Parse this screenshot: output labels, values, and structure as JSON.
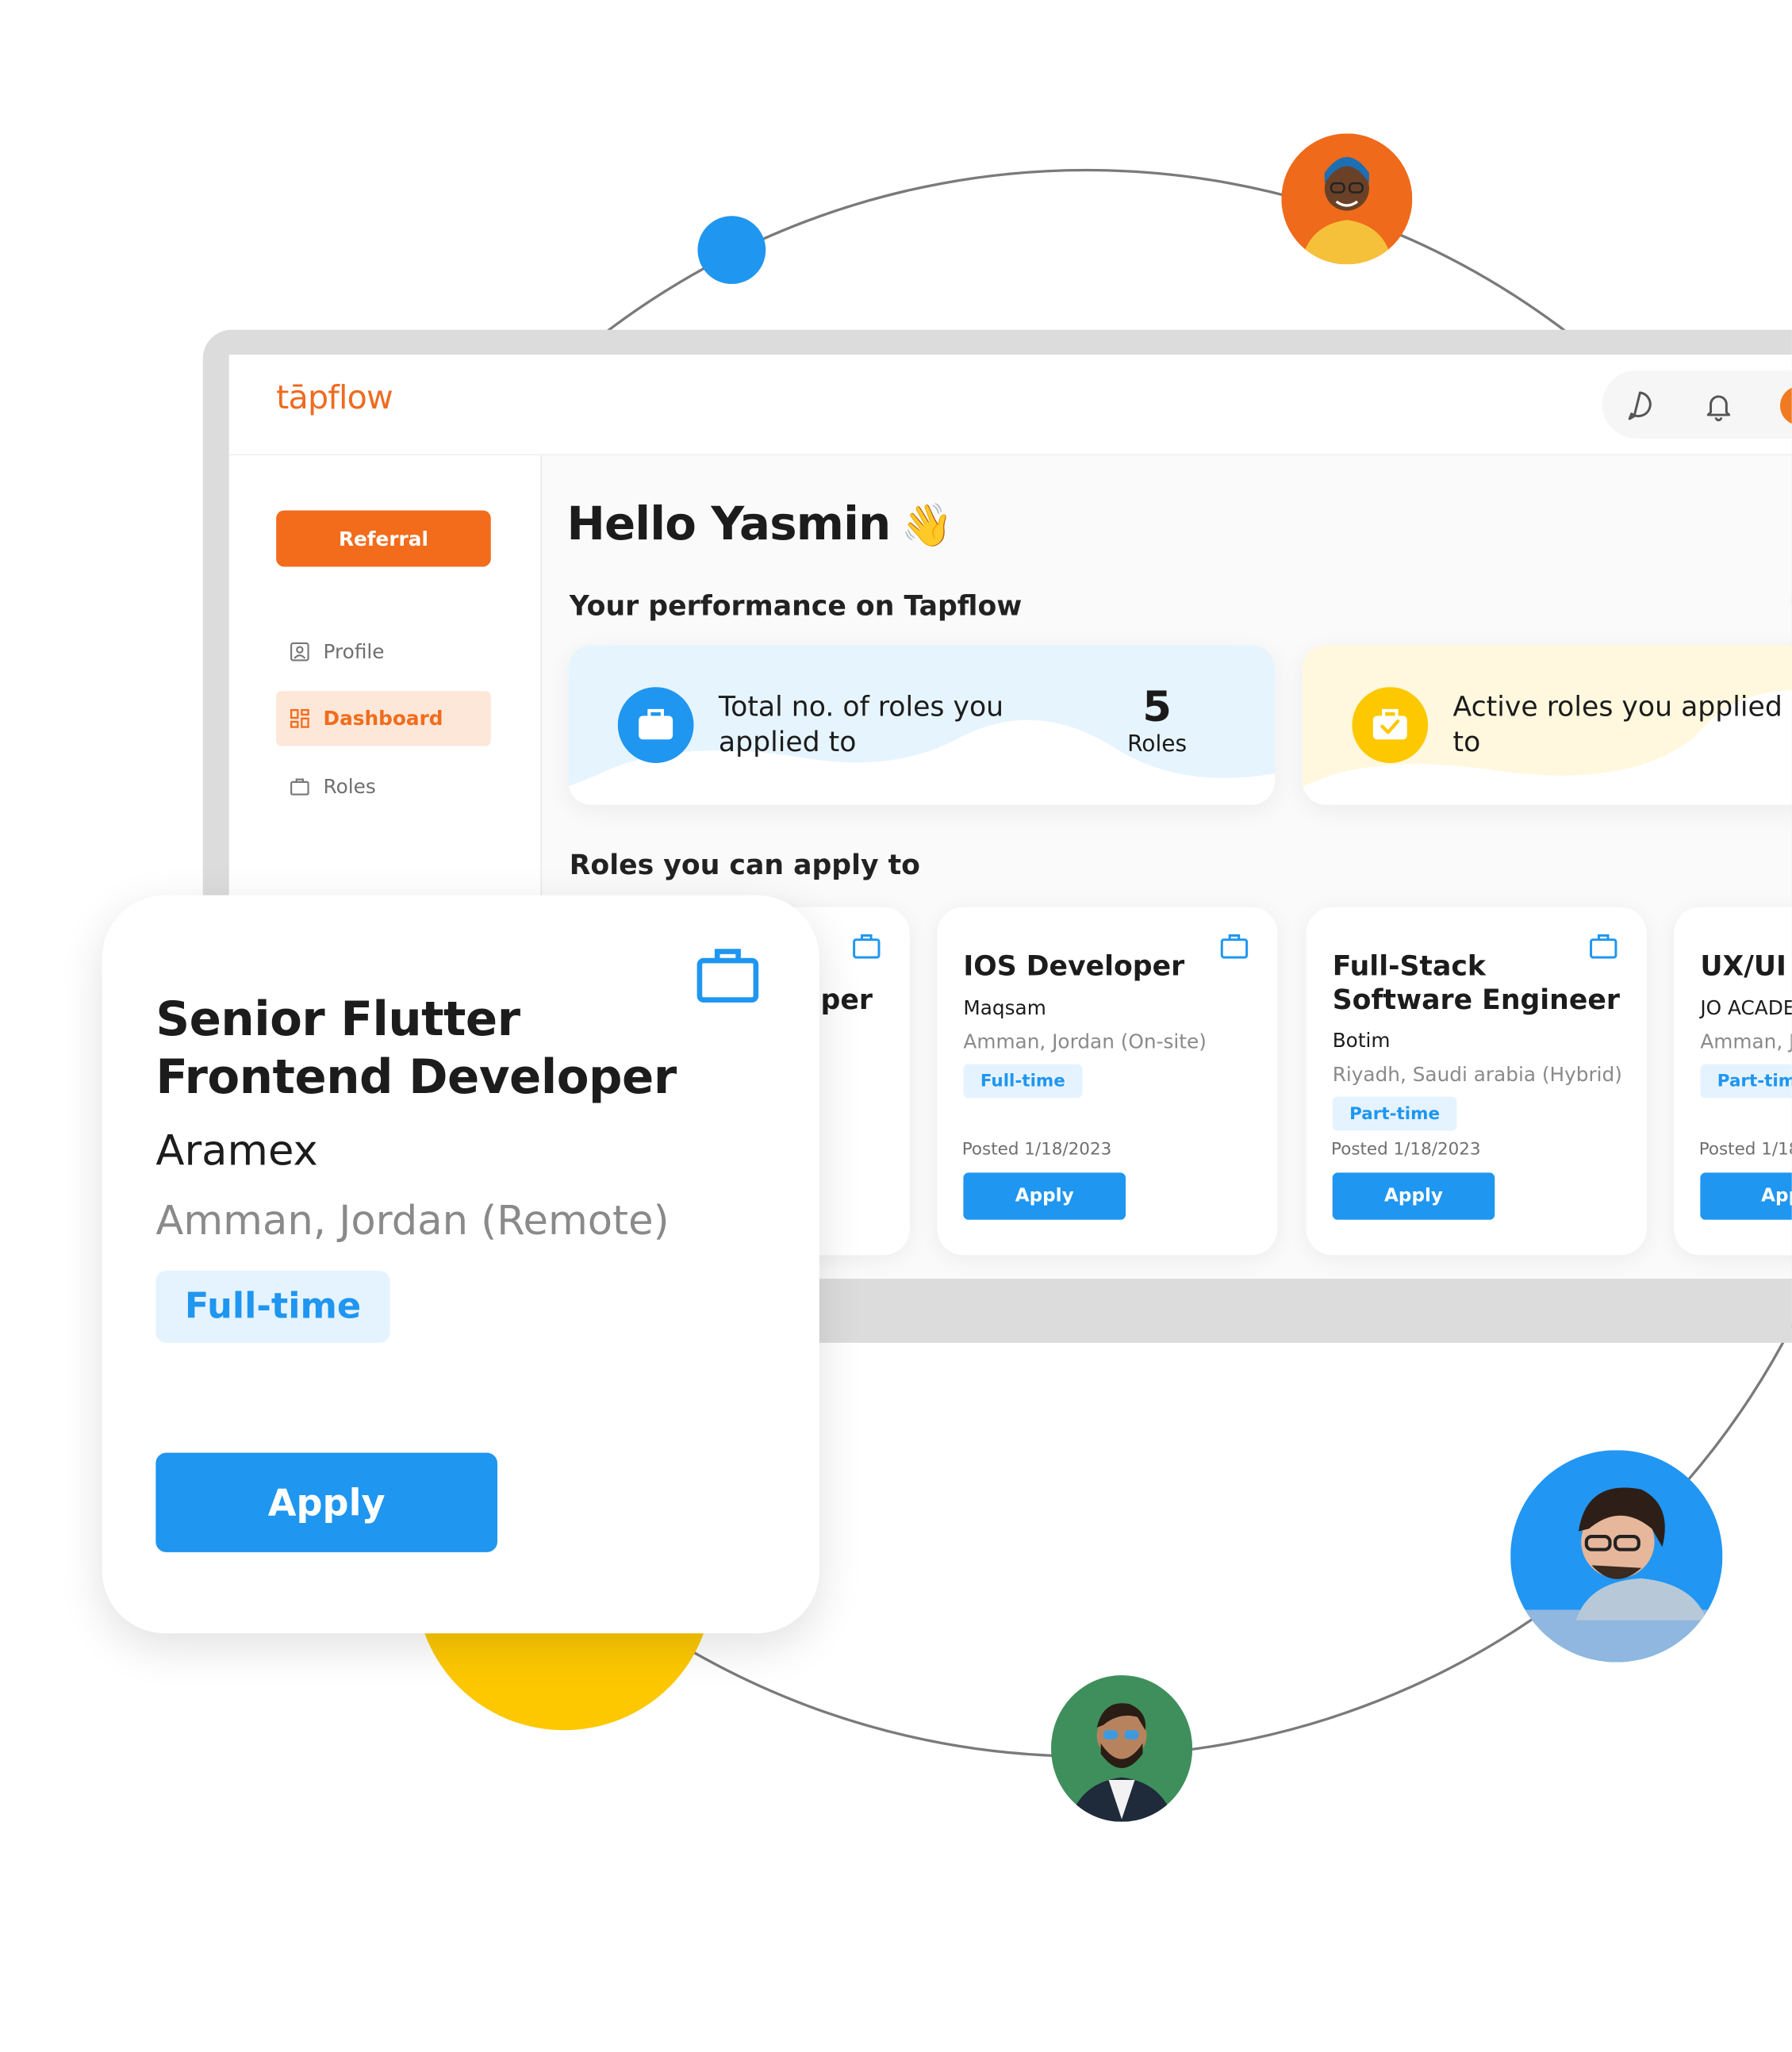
{
  "app": {
    "logo": "tāpflow"
  },
  "sidebar": {
    "referral_label": "Referral",
    "items": [
      {
        "label": "Profile",
        "icon": "profile-icon",
        "active": false
      },
      {
        "label": "Dashboard",
        "icon": "dashboard-icon",
        "active": true
      },
      {
        "label": "Roles",
        "icon": "briefcase-icon",
        "active": false
      }
    ]
  },
  "header_icons": [
    "chat-icon",
    "bell-icon",
    "user-avatar"
  ],
  "main": {
    "greeting": "Hello Yasmin",
    "greeting_emoji": "👋",
    "performance_title": "Your performance on Tapflow",
    "stats": [
      {
        "label": "Total no. of roles you applied to",
        "value": "5",
        "unit": "Roles",
        "icon": "briefcase-icon",
        "color": "#1f96f0"
      },
      {
        "label": "Active roles you applied to",
        "icon": "briefcase-check-icon",
        "color": "#fdc800"
      }
    ],
    "roles_title": "Roles you can apply to",
    "roles": [
      {
        "title": "Senior Flutter Frontend Developer",
        "partial_title": "per"
      },
      {
        "title": "IOS Developer",
        "company": "Maqsam",
        "location": "Amman, Jordan (On-site)",
        "type": "Full-time",
        "posted": "Posted 1/18/2023",
        "apply": "Apply"
      },
      {
        "title": "Full-Stack Software Engineer",
        "company": "Botim",
        "location": "Riyadh, Saudi arabia (Hybrid)",
        "type": "Part-time",
        "posted": "Posted 1/18/2023",
        "apply": "Apply"
      },
      {
        "title": "UX/UI",
        "company": "JO ACADE",
        "location": "Amman, J",
        "type": "Part-time",
        "posted": "Posted 1/18",
        "apply": "App"
      }
    ]
  },
  "featured_role": {
    "title": "Senior Flutter Frontend Developer",
    "company": "Aramex",
    "location": "Amman, Jordan (Remote)",
    "type": "Full-time",
    "apply": "Apply"
  },
  "colors": {
    "accent_orange": "#f26c1c",
    "accent_blue": "#1f96f0",
    "accent_yellow": "#fdc800"
  }
}
